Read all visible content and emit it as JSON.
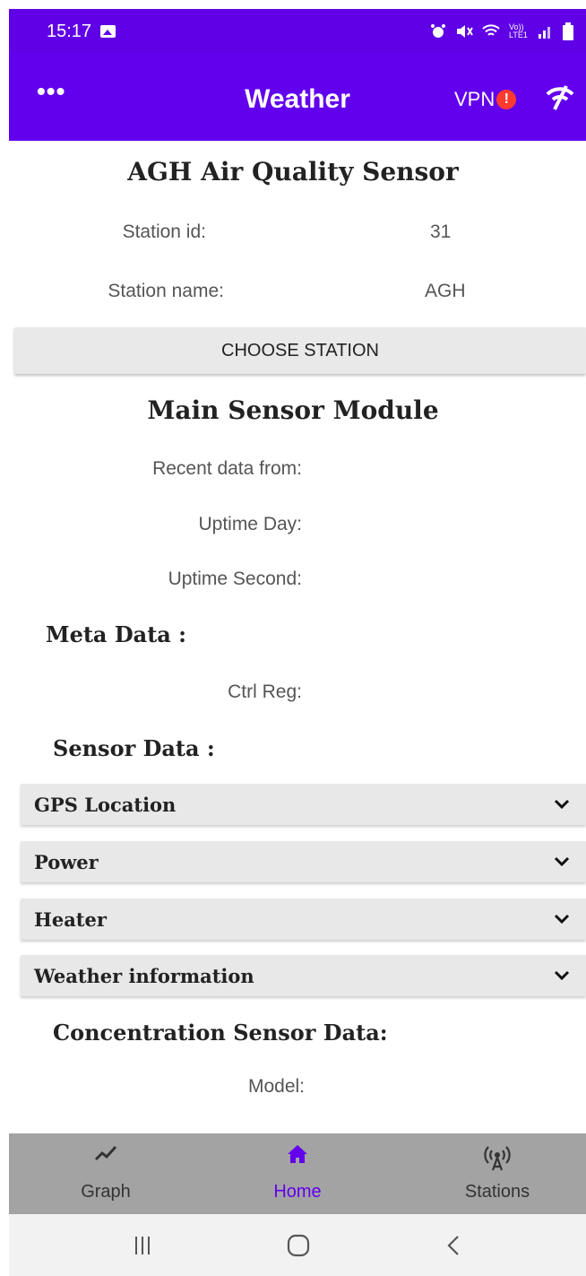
{
  "status_bar": {
    "time": "15:17",
    "network_label": "Vo)) LTE1"
  },
  "app_bar": {
    "menu": "•••",
    "title": "Weather",
    "vpn_label": "VPN",
    "vpn_badge": "!"
  },
  "station": {
    "title": "AGH Air Quality Sensor",
    "id_label": "Station id:",
    "id_value": "31",
    "name_label": "Station name:",
    "name_value": "AGH",
    "choose_button": "CHOOSE STATION"
  },
  "main_module": {
    "title": "Main Sensor Module",
    "recent_label": "Recent data from:",
    "uptime_day_label": "Uptime Day:",
    "uptime_second_label": "Uptime Second:"
  },
  "meta": {
    "title": "Meta Data :",
    "ctrl_reg_label": "Ctrl Reg:"
  },
  "sensor": {
    "title": "Sensor Data :",
    "sections": [
      "GPS Location",
      "Power",
      "Heater",
      "Weather information"
    ]
  },
  "concentration": {
    "title": "Concentration Sensor Data:",
    "model_label": "Model:"
  },
  "bottom_nav": {
    "items": [
      {
        "label": "Graph",
        "icon": "chart-line-icon"
      },
      {
        "label": "Home",
        "icon": "home-icon"
      },
      {
        "label": "Stations",
        "icon": "antenna-icon"
      }
    ],
    "active": "Home"
  },
  "colors": {
    "primary": "#6200ee",
    "status_bar": "#5f00e6",
    "nav_bg": "#a3a3a3",
    "badge": "#ff3b2f"
  }
}
